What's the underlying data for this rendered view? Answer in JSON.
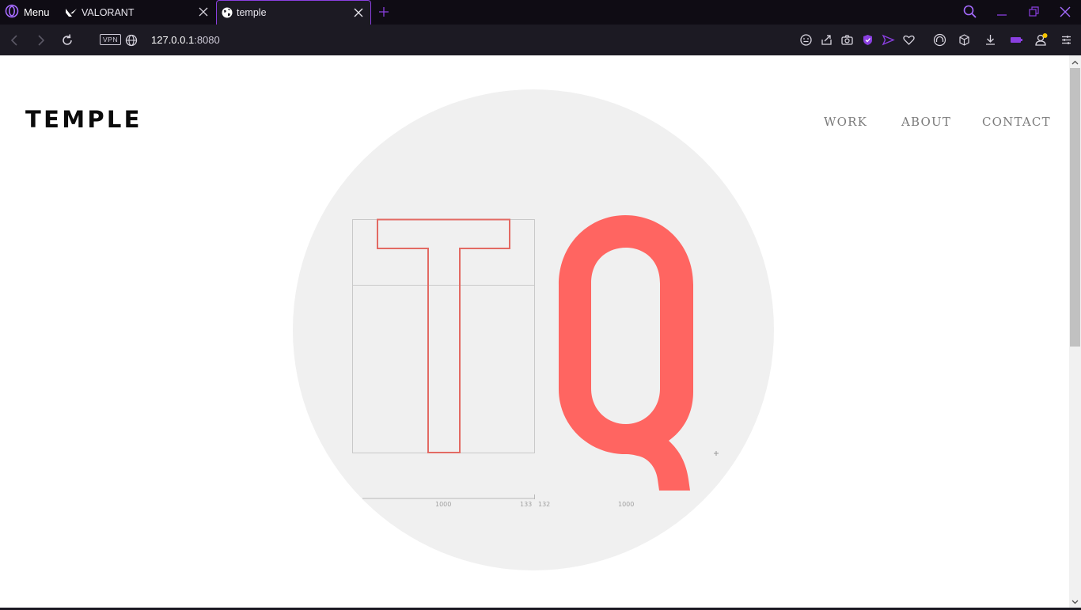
{
  "browser": {
    "menu_label": "Menu",
    "tabs": [
      {
        "title": "VALORANT",
        "icon": "valorant-icon",
        "active": false
      },
      {
        "title": "temple",
        "icon": "globe-icon",
        "active": true
      }
    ],
    "vpn_label": "VPN",
    "url_host": "127.0.0.1",
    "url_port": ":8080",
    "accent": "#8a3fe0"
  },
  "site": {
    "logo": "TEMPLE",
    "nav": [
      "WORK",
      "ABOUT",
      "CONTACT"
    ],
    "hero": {
      "letter_outline": "T",
      "letter_filled": "Q",
      "accent": "#ff6561",
      "measurements": [
        "1000",
        "133",
        "132",
        "1000"
      ]
    }
  }
}
